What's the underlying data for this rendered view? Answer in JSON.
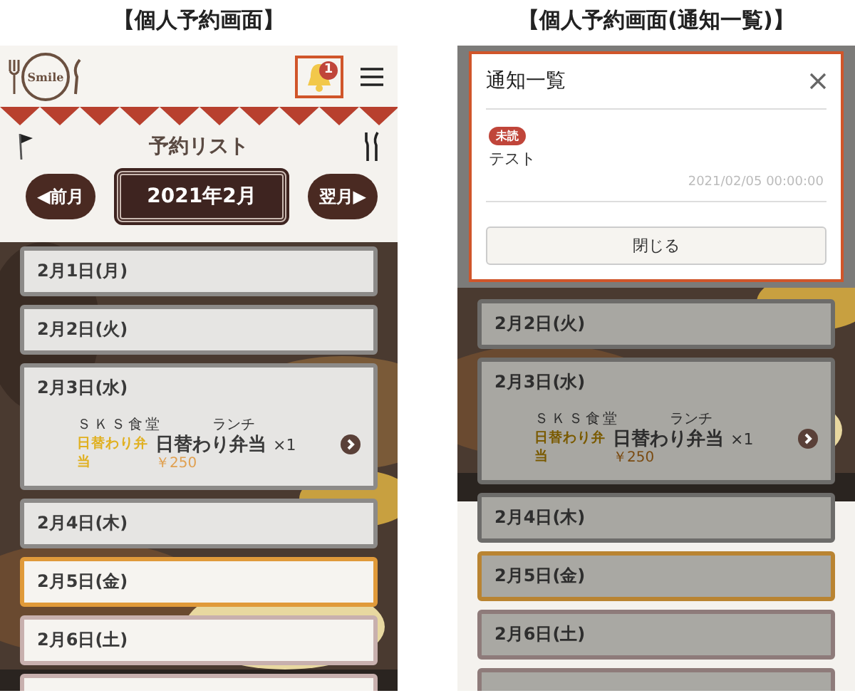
{
  "screens": [
    {
      "kind": "list",
      "caption": "【個人予約画面】",
      "header": {
        "logo_text": "Smile",
        "badge": "1",
        "bell_highlighted": true
      },
      "title": "予約リスト",
      "prev_button": "◀前月",
      "month": "2021年2月",
      "next_button": "翌月▶",
      "days": [
        {
          "date": "2月1日(月)",
          "selected": false,
          "weekend": false
        },
        {
          "date": "2月2日(火)",
          "selected": false,
          "weekend": false
        },
        {
          "date": "2月3日(水)",
          "selected": false,
          "weekend": false,
          "order": {
            "shop": "ＳＫＳ食堂",
            "meal": "ランチ",
            "tag": "日替わり弁当",
            "item": "日替わり弁当",
            "quantity": "×1",
            "price": "￥250"
          }
        },
        {
          "date": "2月4日(木)",
          "selected": false,
          "weekend": false
        },
        {
          "date": "2月5日(金)",
          "selected": true,
          "weekend": false
        },
        {
          "date": "2月6日(土)",
          "selected": false,
          "weekend": true
        }
      ]
    },
    {
      "kind": "modal",
      "caption": "【個人予約画面(通知一覧)】",
      "modal": {
        "title": "通知一覧",
        "notifications": [
          {
            "badge": "未読",
            "text": "テスト",
            "time": "2021/02/05 00:00:00"
          }
        ],
        "close_button": "閉じる"
      },
      "days": [
        {
          "date": "2月2日(火)",
          "selected": false,
          "weekend": false
        },
        {
          "date": "2月3日(水)",
          "selected": false,
          "weekend": false,
          "order": {
            "shop": "ＳＫＳ食堂",
            "meal": "ランチ",
            "tag": "日替わり弁当",
            "item": "日替わり弁当",
            "quantity": "×1",
            "price": "￥250"
          }
        },
        {
          "date": "2月4日(木)",
          "selected": false,
          "weekend": false
        },
        {
          "date": "2月5日(金)",
          "selected": true,
          "weekend": false
        },
        {
          "date": "2月6日(土)",
          "selected": false,
          "weekend": true
        }
      ]
    }
  ]
}
